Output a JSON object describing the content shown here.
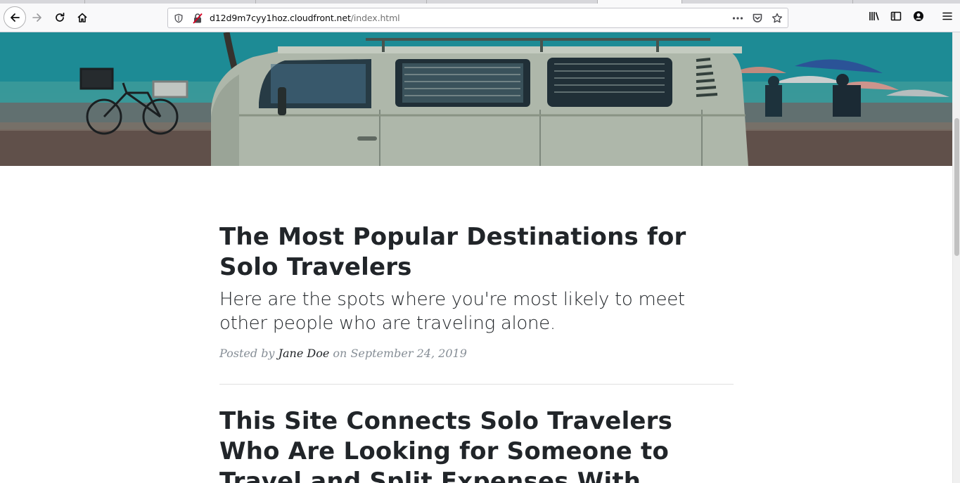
{
  "browser": {
    "url_host": "d12d9m7cyy1hoz.cloudfront.net",
    "url_path": "/index.html",
    "icons": {
      "back": "back-arrow-icon",
      "forward": "forward-arrow-icon",
      "reload": "reload-icon",
      "home": "home-icon",
      "tracking": "shield-icon",
      "insecure": "insecure-lock-icon",
      "page_actions": "more-icon",
      "pocket": "pocket-icon",
      "bookmark": "star-icon",
      "library": "library-icon",
      "sidebar": "sidebar-icon",
      "account": "account-icon",
      "menu": "hamburger-menu-icon"
    }
  },
  "posts": [
    {
      "title": "The Most Popular Destinations for Solo Travelers",
      "subtitle": "Here are the spots where you're most likely to meet other people who are traveling alone.",
      "meta_prefix": "Posted by",
      "author": "Jane Doe",
      "meta_on": "on",
      "date": "September 24, 2019"
    },
    {
      "title": "This Site Connects Solo Travelers Who Are Looking for Someone to Travel and Split Expenses With"
    }
  ],
  "colors": {
    "heading": "#212529",
    "meta": "#868e96",
    "chrome": "#f9f9fa"
  }
}
